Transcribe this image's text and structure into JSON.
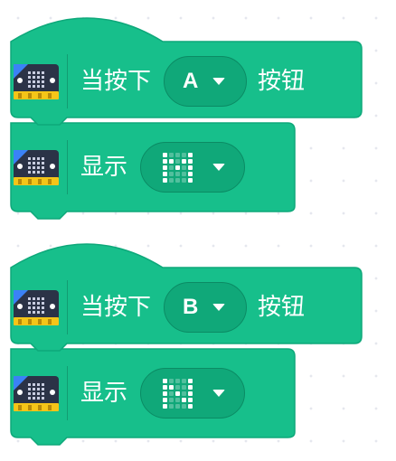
{
  "colors": {
    "block_fill": "#17bf8b",
    "block_stroke": "#0ea87a",
    "field_fill": "#10a879"
  },
  "icon": "microbit-board-icon",
  "scripts": [
    {
      "hat": {
        "label_before": "当按下",
        "button_value": "A",
        "label_after": "按钮"
      },
      "action": {
        "label": "显示",
        "matrix": [
          [
            1,
            0,
            0,
            0,
            1
          ],
          [
            1,
            1,
            0,
            1,
            1
          ],
          [
            1,
            0,
            1,
            0,
            1
          ],
          [
            1,
            0,
            0,
            0,
            1
          ],
          [
            1,
            0,
            0,
            0,
            1
          ]
        ]
      }
    },
    {
      "hat": {
        "label_before": "当按下",
        "button_value": "B",
        "label_after": "按钮"
      },
      "action": {
        "label": "显示",
        "matrix": [
          [
            1,
            0,
            0,
            0,
            1
          ],
          [
            1,
            1,
            0,
            0,
            1
          ],
          [
            1,
            0,
            1,
            0,
            1
          ],
          [
            1,
            0,
            0,
            1,
            1
          ],
          [
            1,
            0,
            0,
            0,
            1
          ]
        ]
      }
    }
  ]
}
